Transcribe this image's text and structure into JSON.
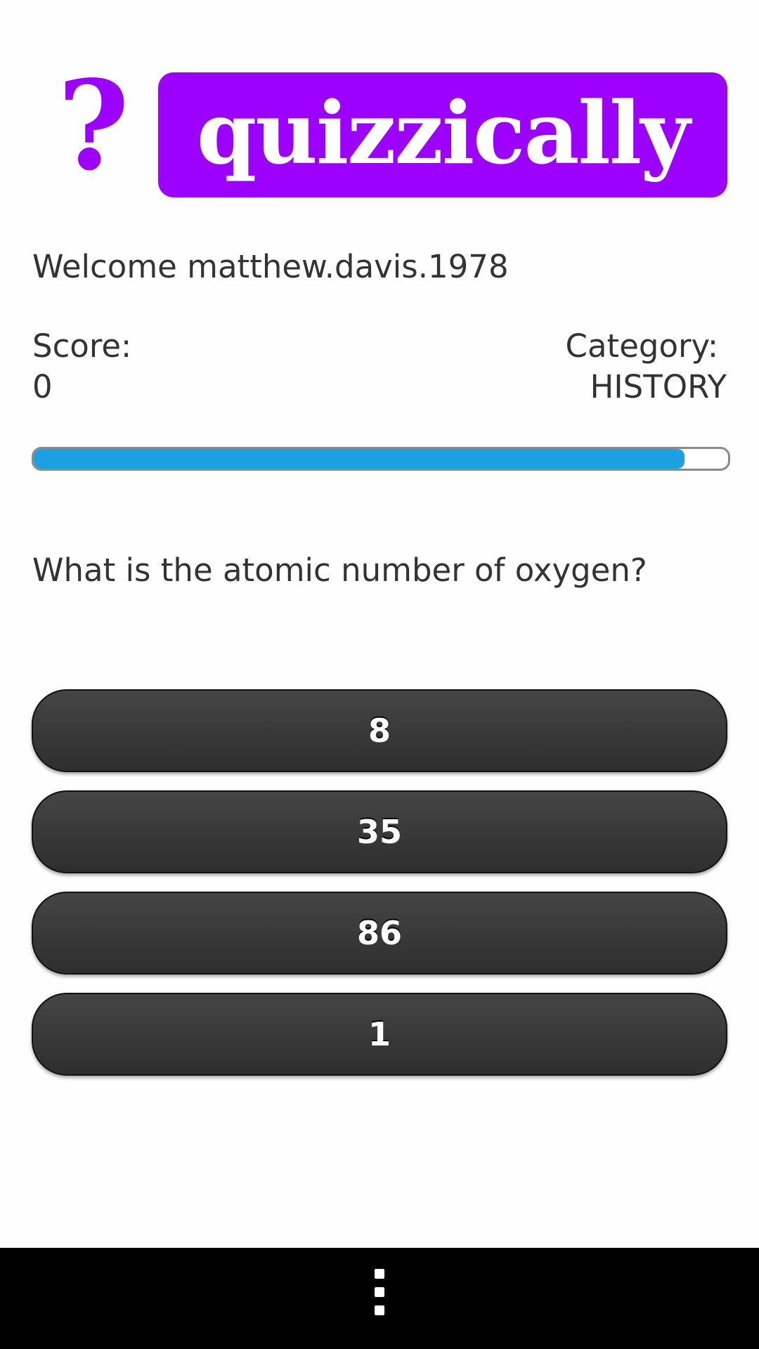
{
  "logo": {
    "symbol": "?",
    "name": "quizzically",
    "color": "#9c00ff"
  },
  "welcome": "Welcome matthew.davis.1978",
  "score": {
    "label": "Score:",
    "value": "0"
  },
  "category": {
    "label": "Category:",
    "value": "HISTORY"
  },
  "timer": {
    "progress_percent": 93.7,
    "color": "#1ba1e2"
  },
  "question": "What is the atomic number of oxygen?",
  "answers": [
    {
      "label": "8"
    },
    {
      "label": "35"
    },
    {
      "label": "86"
    },
    {
      "label": "1"
    }
  ],
  "navbar": {
    "menu_icon": "overflow-menu-icon"
  }
}
